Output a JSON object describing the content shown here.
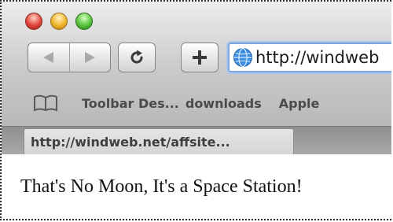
{
  "window": {
    "traffic_lights": [
      "close",
      "minimize",
      "zoom"
    ],
    "colors": {
      "close": "#e0443a",
      "minimize": "#f1b52a",
      "zoom": "#56c23a",
      "address_focus": "#7fa6d8"
    }
  },
  "toolbar": {
    "back_icon": "back-arrow-icon",
    "forward_icon": "forward-arrow-icon",
    "reload_icon": "reload-icon",
    "add_bookmark_icon": "plus-icon",
    "address": {
      "icon": "globe-icon",
      "url": "http://windweb"
    }
  },
  "bookmarks_bar": {
    "icon": "open-book-icon",
    "items": [
      {
        "label": "Toolbar Des..."
      },
      {
        "label": "downloads"
      },
      {
        "label": "Apple"
      }
    ]
  },
  "tabs": [
    {
      "label": "http://windweb.net/affsite..."
    }
  ],
  "page": {
    "text": "That's No Moon, It's a Space Station!"
  }
}
